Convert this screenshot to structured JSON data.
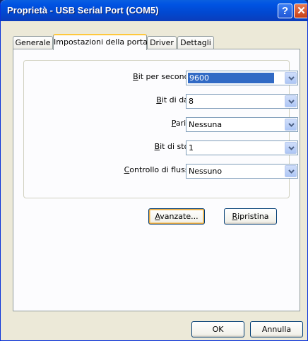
{
  "window": {
    "title": "Proprietà - USB Serial Port (COM5)",
    "help_glyph": "?",
    "close_glyph": "✕"
  },
  "tabs": [
    {
      "label": "Generale",
      "active": false
    },
    {
      "label": "Impostazioni della porta",
      "active": true
    },
    {
      "label": "Driver",
      "active": false
    },
    {
      "label": "Dettagli",
      "active": false
    }
  ],
  "settings": {
    "baud": {
      "mnemonic": "B",
      "rest": "it per secondo:",
      "value": "9600"
    },
    "data": {
      "mnemonic": "B",
      "rest": "it di dati:",
      "value": "8"
    },
    "parity": {
      "mnemonic": "P",
      "rest": "arità:",
      "value": "Nessuna"
    },
    "stop": {
      "mnemonic": "B",
      "rest": "it di stop:",
      "value": "1"
    },
    "flow": {
      "mnemonic": "C",
      "rest": "ontrollo di flusso:",
      "value": "Nessuno"
    }
  },
  "buttons": {
    "advanced": {
      "mnemonic": "A",
      "rest": "vanzate..."
    },
    "restore": {
      "mnemonic": "R",
      "rest": "ipristina"
    },
    "ok": "OK",
    "cancel": "Annulla"
  }
}
